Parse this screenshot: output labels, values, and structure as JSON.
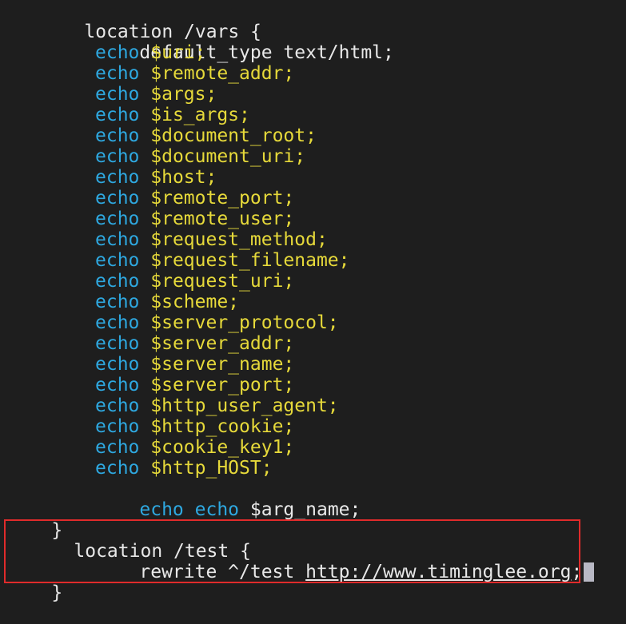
{
  "editor": {
    "vars_block": {
      "header": "location /vars {",
      "default_type": "default_type text/html;",
      "echo_keyword": "echo",
      "echo_lines": [
        "$uri;",
        "$remote_addr;",
        "$args;",
        "$is_args;",
        "$document_root;",
        "$document_uri;",
        "$host;",
        "$remote_port;",
        "$remote_user;",
        "$request_method;",
        "$request_filename;",
        "$request_uri;",
        "$scheme;",
        "$server_protocol;",
        "$server_addr;",
        "$server_name;",
        "$server_port;",
        "$http_user_agent;",
        "$http_cookie;",
        "$cookie_key1;",
        "$http_HOST;"
      ],
      "last_echo_extra_keyword": "echo",
      "last_echo_var": "$arg_name;",
      "closing_brace": "}"
    },
    "test_block": {
      "header": "location /test {",
      "rewrite_text": "rewrite ^/test ",
      "rewrite_url": "http://www.timinglee.org",
      "rewrite_end": ";",
      "closing_brace": "}"
    },
    "colors": {
      "background": "#1e1e1e",
      "keyword": "#2ea8e0",
      "variable": "#e6d93a",
      "text": "#e8e8e8",
      "highlight_border": "#e02b2b",
      "cursor": "#b9b9c5"
    }
  }
}
